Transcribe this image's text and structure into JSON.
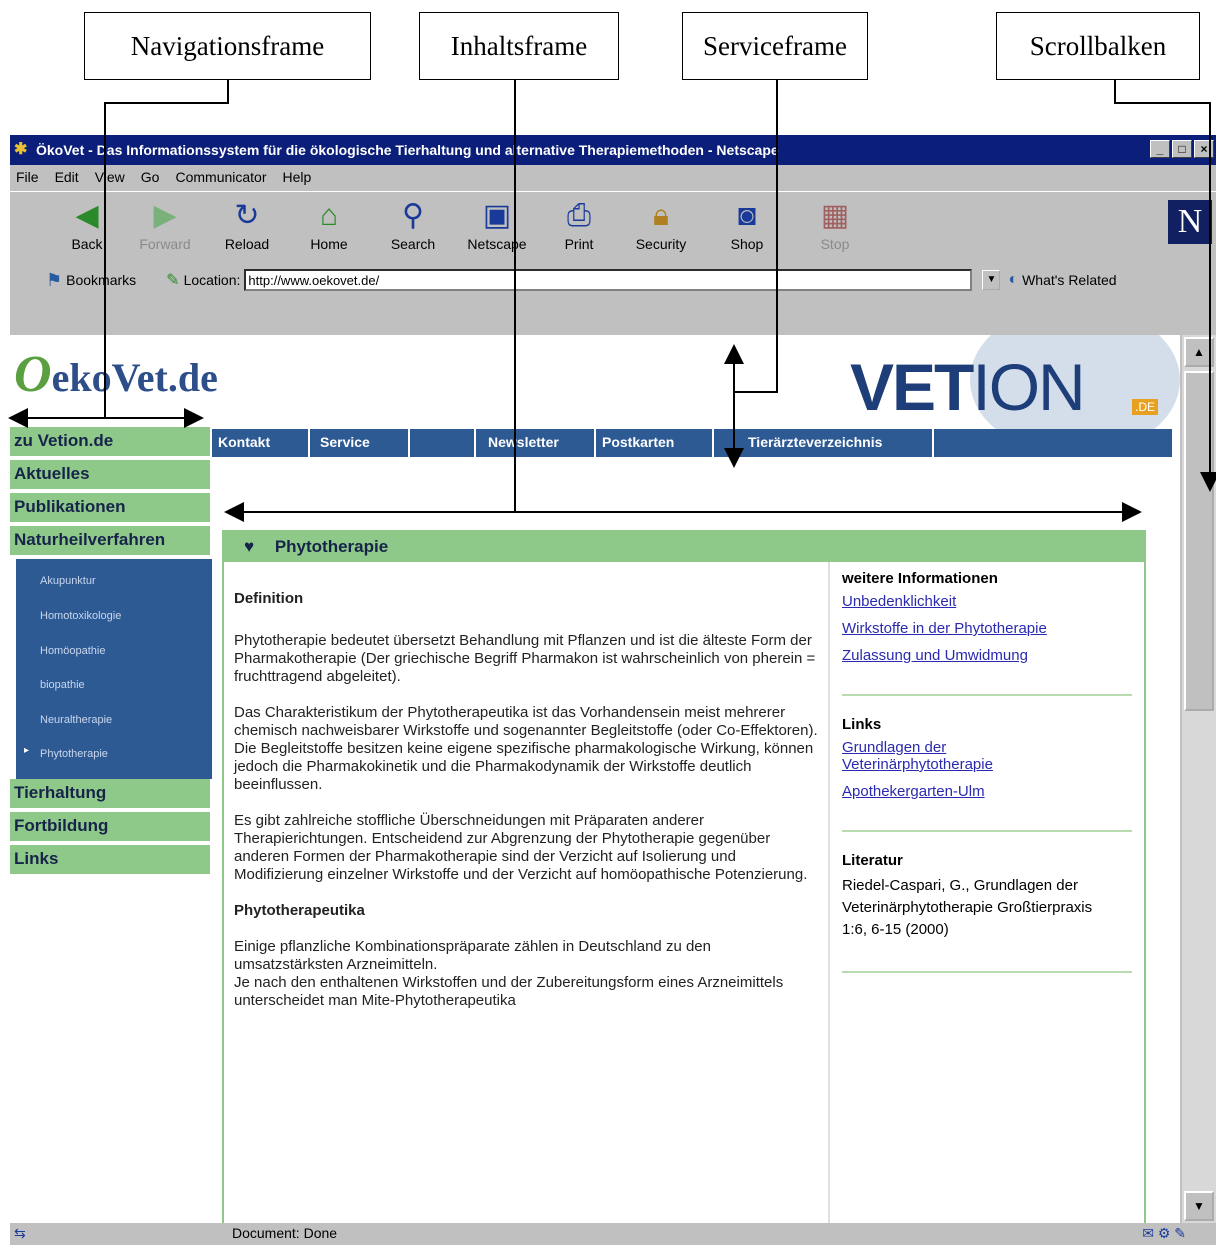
{
  "annotations": {
    "navigation": "Navigationsframe",
    "content": "Inhaltsframe",
    "service": "Serviceframe",
    "scrollbar": "Scrollbalken"
  },
  "window": {
    "title": "ÖkoVet - Das Informationssystem für die ökologische Tierhaltung und alternative Therapiemethoden - Netscape"
  },
  "menu": [
    "File",
    "Edit",
    "View",
    "Go",
    "Communicator",
    "Help"
  ],
  "toolbar": {
    "buttons": [
      "Back",
      "Forward",
      "Reload",
      "Home",
      "Search",
      "Netscape",
      "Print",
      "Security",
      "Shop",
      "Stop"
    ]
  },
  "location": {
    "bookmarks_label": "Bookmarks",
    "location_label": "Location:",
    "url": "http://www.oekovet.de/",
    "related": "What's Related"
  },
  "site": {
    "logo": "OekoVet.de",
    "vetion_logo": "VETION.DE",
    "nav_items": [
      "zu Vetion.de",
      "Aktuelles",
      "Publikationen",
      "Naturheilverfahren"
    ],
    "sub_items": [
      "Akupunktur",
      "Homotoxikologie",
      "Homöopathie",
      "biopathie",
      "Neuraltherapie",
      "Phytotherapie"
    ],
    "nav_items_bottom": [
      "Tierhaltung",
      "Fortbildung",
      "Links"
    ],
    "service_items": [
      "Kontakt",
      "Service",
      "Newsletter",
      "Postkarten",
      "Tierärzteverzeichnis"
    ]
  },
  "main": {
    "title": "Phytotherapie",
    "definition_heading": "Definition",
    "p1": "Phytotherapie bedeutet übersetzt Behandlung mit Pflanzen und ist die älteste Form der Pharmakotherapie (Der griechische Begriff Pharmakon ist wahrscheinlich von pherein = fruchttragend abgeleitet).",
    "p2": "Das Charakteristikum der Phytotherapeutika ist das Vorhandensein meist mehrerer chemisch nachweisbarer Wirkstoffe und sogenannter Begleitstoffe (oder Co-Effektoren). Die Begleitstoffe besitzen keine eigene spezifische pharmakologische Wirkung, können jedoch die Pharmakokinetik und die Pharmakodynamik der Wirkstoffe deutlich beeinflussen.",
    "p3": "Es gibt zahlreiche stoffliche Überschneidungen mit Präparaten anderer Therapierichtungen. Entscheidend zur Abgrenzung der Phytotherapie gegenüber anderen Formen der Pharmakotherapie sind der Verzicht auf Isolierung und Modifizierung einzelner Wirkstoffe und der Verzicht auf homöopathische Potenzierung.",
    "h2": "Phytotherapeutika",
    "p4": "Einige pflanzliche Kombinationspräparate zählen in Deutschland zu den umsatzstärksten Arzneimitteln.",
    "p5": "Je nach den enthaltenen Wirkstoffen und der Zubereitungsform eines Arzneimittels unterscheidet man Mite-Phytotherapeutika"
  },
  "sidebar": {
    "info_heading": "weitere Informationen",
    "info_links": [
      "Unbedenklichkeit",
      "Wirkstoffe in der Phytotherapie",
      "Zulassung und Umwidmung"
    ],
    "links_heading": "Links",
    "links": [
      "Grundlagen der Veterinärphytotherapie",
      "Apothekergarten-Ulm"
    ],
    "literature_heading": "Literatur",
    "literature": "Riedel-Caspari, G., Grundlagen der Veterinärphytotherapie Großtierpraxis 1:6, 6-15 (2000)"
  },
  "status": {
    "message": "Document: Done"
  }
}
